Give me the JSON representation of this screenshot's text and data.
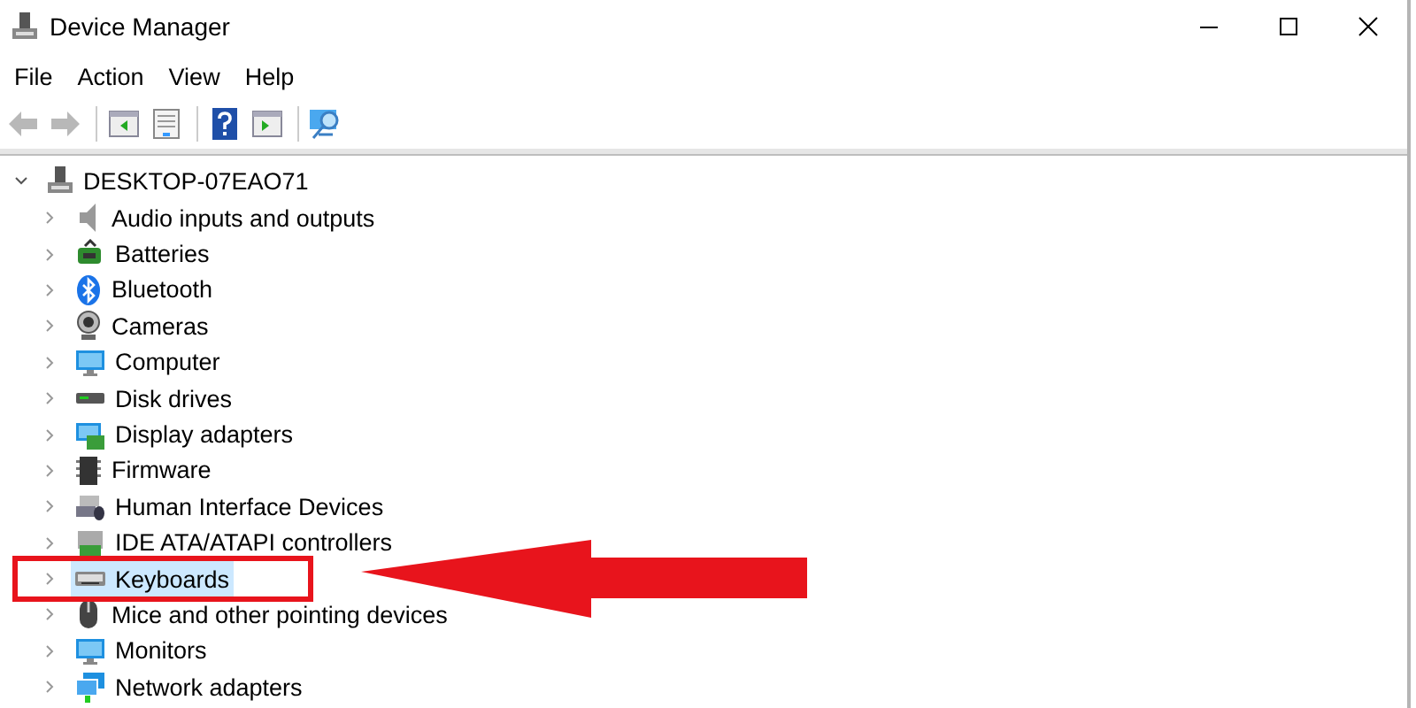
{
  "window": {
    "title": "Device Manager"
  },
  "menu": [
    "File",
    "Action",
    "View",
    "Help"
  ],
  "toolbar": [
    {
      "kind": "back",
      "disabled": true
    },
    {
      "kind": "forward",
      "disabled": true
    },
    {
      "kind": "sep"
    },
    {
      "kind": "tree",
      "disabled": false
    },
    {
      "kind": "properties",
      "disabled": false
    },
    {
      "kind": "sep"
    },
    {
      "kind": "help",
      "disabled": false
    },
    {
      "kind": "pane",
      "disabled": false
    },
    {
      "kind": "sep"
    },
    {
      "kind": "scan",
      "disabled": false
    }
  ],
  "tree": {
    "label": "DESKTOP-07EAO71",
    "expanded": true,
    "children": [
      {
        "label": "Audio inputs and outputs",
        "expanded": false,
        "selected": false
      },
      {
        "label": "Batteries",
        "expanded": false,
        "selected": false
      },
      {
        "label": "Bluetooth",
        "expanded": false,
        "selected": false
      },
      {
        "label": "Cameras",
        "expanded": false,
        "selected": false
      },
      {
        "label": "Computer",
        "expanded": false,
        "selected": false
      },
      {
        "label": "Disk drives",
        "expanded": false,
        "selected": false
      },
      {
        "label": "Display adapters",
        "expanded": false,
        "selected": false
      },
      {
        "label": "Firmware",
        "expanded": false,
        "selected": false
      },
      {
        "label": "Human Interface Devices",
        "expanded": false,
        "selected": false
      },
      {
        "label": "IDE ATA/ATAPI controllers",
        "expanded": false,
        "selected": false
      },
      {
        "label": "Keyboards",
        "expanded": false,
        "selected": true
      },
      {
        "label": "Mice and other pointing devices",
        "expanded": false,
        "selected": false
      },
      {
        "label": "Monitors",
        "expanded": false,
        "selected": false
      },
      {
        "label": "Network adapters",
        "expanded": false,
        "selected": false
      }
    ]
  }
}
